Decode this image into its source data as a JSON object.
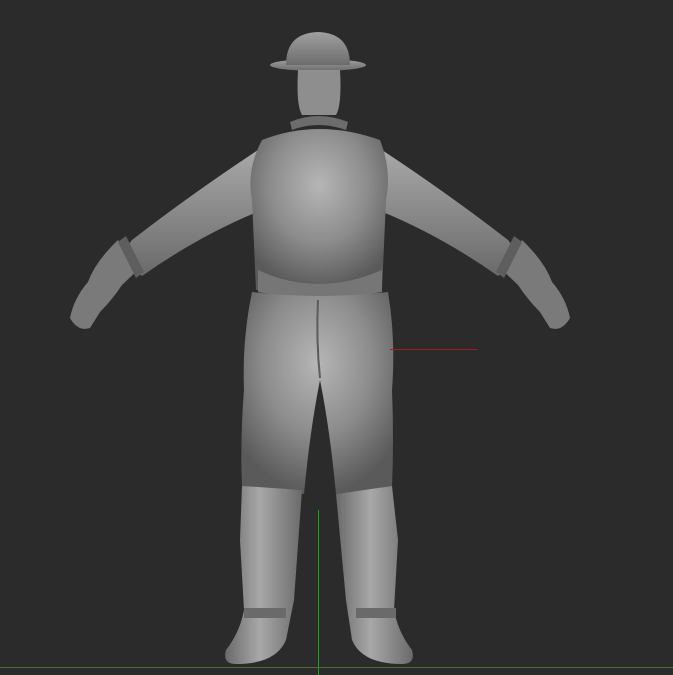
{
  "canvas": {
    "background_color": "#2b2b2b"
  },
  "colors": {
    "axis_x": "#a21c1c",
    "axis_y": "#1e9e1e",
    "ground_line": "#4c6a3a",
    "model_base": "#8a8a8a",
    "model_highlight": "#b8b8b8",
    "model_shadow": "#4e4e4e"
  },
  "icons": {
    "model": "sculpted-figure-back-view-icon"
  }
}
